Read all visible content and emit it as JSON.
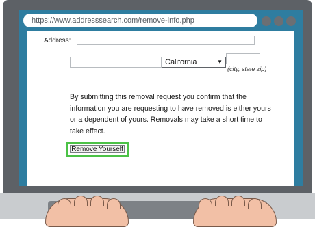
{
  "browser": {
    "url": "https://www.addresssearch.com/remove-info.php"
  },
  "form": {
    "address_label": "Address:",
    "address_value": "",
    "city_value": "",
    "state_selected": "California",
    "zip_value": "",
    "city_state_zip_hint": "(city, state zip)",
    "disclaimer": "By submitting this removal request you confirm that the information you are requesting to have removed is either yours or a dependent of yours. Removals may take a short time to take effect.",
    "submit_label": "Remove Yourself"
  },
  "colors": {
    "screen_accent": "#2e7da0",
    "highlight": "#4cc247",
    "bezel": "#5d6166"
  },
  "icons": {
    "window_controls": [
      "circle-icon",
      "circle-icon",
      "circle-icon"
    ],
    "select_arrow": "triangle-down-icon"
  }
}
